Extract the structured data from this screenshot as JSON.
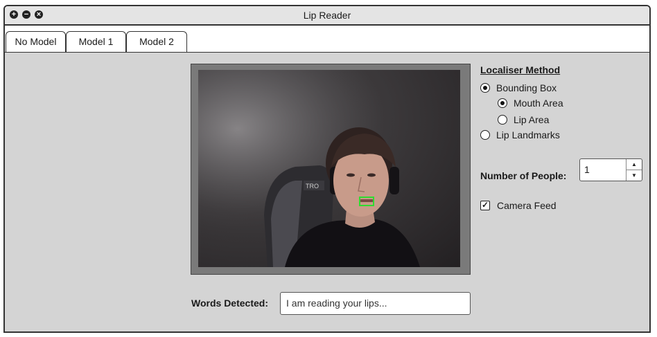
{
  "window": {
    "title": "Lip Reader",
    "controls": {
      "maximize_icon": "plus-circle-icon",
      "minimize_icon": "minus-circle-icon",
      "close_icon": "close-circle-icon"
    }
  },
  "tabs": [
    {
      "label": "No Model",
      "active": true
    },
    {
      "label": "Model 1",
      "active": false
    },
    {
      "label": "Model 2",
      "active": false
    }
  ],
  "words": {
    "label": "Words Detected:",
    "value": "I am reading your lips..."
  },
  "localiser": {
    "title": "Localiser Method",
    "options": [
      {
        "label": "Bounding Box",
        "selected": true
      },
      {
        "label": "Mouth Area",
        "selected": true
      },
      {
        "label": "Lip Area",
        "selected": false
      },
      {
        "label": "Lip Landmarks",
        "selected": false
      }
    ]
  },
  "people": {
    "label": "Number of People:",
    "value": "1"
  },
  "camera": {
    "label": "Camera Feed",
    "checked": true
  },
  "colors": {
    "panel_bg": "#d4d4d4",
    "lip_box": "#2fdc2f"
  }
}
